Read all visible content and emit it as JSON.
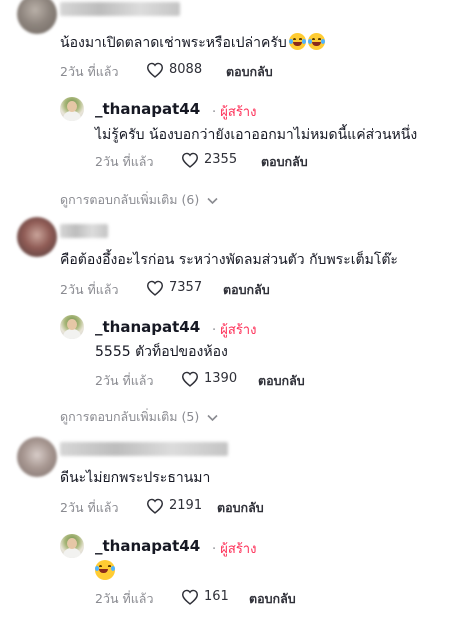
{
  "comments": [
    {
      "text": "น้องมาเปิดตลาดเช่าพระหรือเปล่าครับ",
      "time": "2วัน ที่แล้ว",
      "likes": "8088",
      "reply_label": "ตอบกลับ",
      "replies": [
        {
          "author": "_thanapat44",
          "creator_label": "ผู้สร้าง",
          "text": "ไม่รู้ครับ น้องบอกว่ายังเอาออกมาไม่หมดนี้แค่ส่วนหนึ่ง",
          "time": "2วัน ที่แล้ว",
          "likes": "2355",
          "reply_label": "ตอบกลับ"
        }
      ],
      "view_more": "ดูการตอบกลับเพิ่มเติม (6)"
    },
    {
      "text": "คือต้องอึ้งอะไรก่อน ระหว่างพัดลมส่วนตัว กับพระเต็มโต๊ะ",
      "time": "2วัน ที่แล้ว",
      "likes": "7357",
      "reply_label": "ตอบกลับ",
      "replies": [
        {
          "author": "_thanapat44",
          "creator_label": "ผู้สร้าง",
          "text": "5555 ตัวท็อปของห้อง",
          "time": "2วัน ที่แล้ว",
          "likes": "1390",
          "reply_label": "ตอบกลับ"
        }
      ],
      "view_more": "ดูการตอบกลับเพิ่มเติม (5)"
    },
    {
      "text": "ดีนะไม่ยกพระประธานมา",
      "time": "2วัน ที่แล้ว",
      "likes": "2191",
      "reply_label": "ตอบกลับ",
      "replies": [
        {
          "author": "_thanapat44",
          "creator_label": "ผู้สร้าง",
          "text": "",
          "time": "2วัน ที่แล้ว",
          "likes": "161",
          "reply_label": "ตอบกลับ"
        }
      ]
    }
  ],
  "icons": {
    "like": "heart-outline-icon",
    "more": "chevron-down-icon",
    "emoji": "laughing-tears-emoji"
  },
  "colors": {
    "creator": "#fe2c55",
    "secondary_text": "#8a8b91"
  }
}
